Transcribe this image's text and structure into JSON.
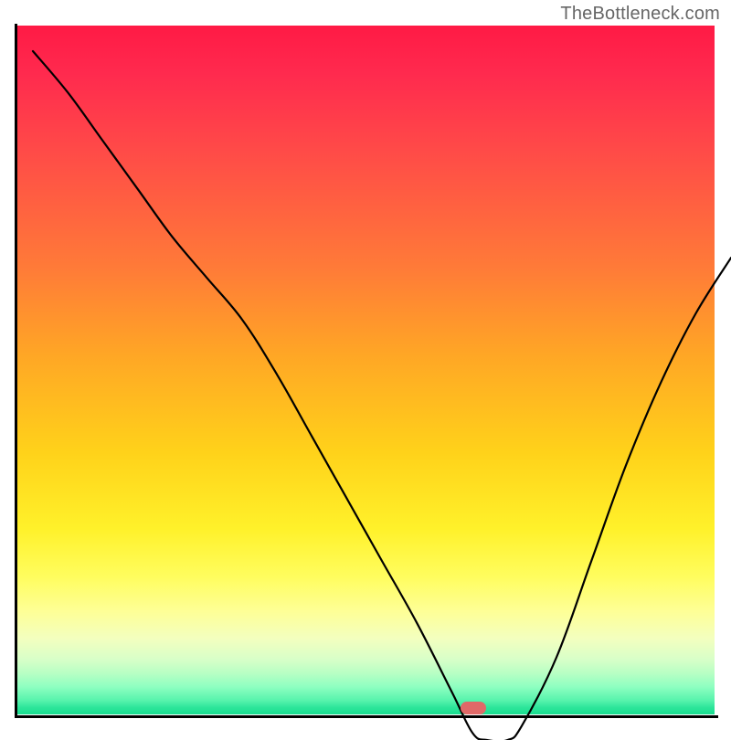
{
  "watermark": "TheBottleneck.com",
  "colors": {
    "top": "#ff1a45",
    "mid": "#ffd21a",
    "bottom": "#18dd90",
    "axis": "#000000",
    "curve": "#000000",
    "marker": "#e06968",
    "watermark_text": "#666666"
  },
  "marker": {
    "x_norm": 0.655,
    "y_norm": 0.995
  },
  "chart_data": {
    "type": "line",
    "title": "",
    "xlabel": "",
    "ylabel": "",
    "xlim": [
      0,
      100
    ],
    "ylim": [
      0,
      100
    ],
    "grid": false,
    "legend_position": "none",
    "annotations": [
      {
        "text": "TheBottleneck.com",
        "position": "top-right"
      }
    ],
    "series": [
      {
        "name": "curve",
        "x": [
          0,
          5,
          10,
          15,
          20,
          25,
          30,
          35,
          40,
          45,
          50,
          55,
          60,
          63,
          65,
          68,
          70,
          75,
          80,
          85,
          90,
          95,
          100
        ],
        "y": [
          100,
          94,
          87,
          80,
          73,
          67,
          61,
          53,
          44,
          35,
          26,
          17,
          7,
          1,
          0,
          0,
          2,
          12,
          26,
          40,
          52,
          62,
          70
        ]
      }
    ],
    "marker_point": {
      "x": 65.5,
      "y": 0
    },
    "background_scale_note": "vertical color gradient maps y-value: top (y=100) red → bottom (y=0) green"
  }
}
